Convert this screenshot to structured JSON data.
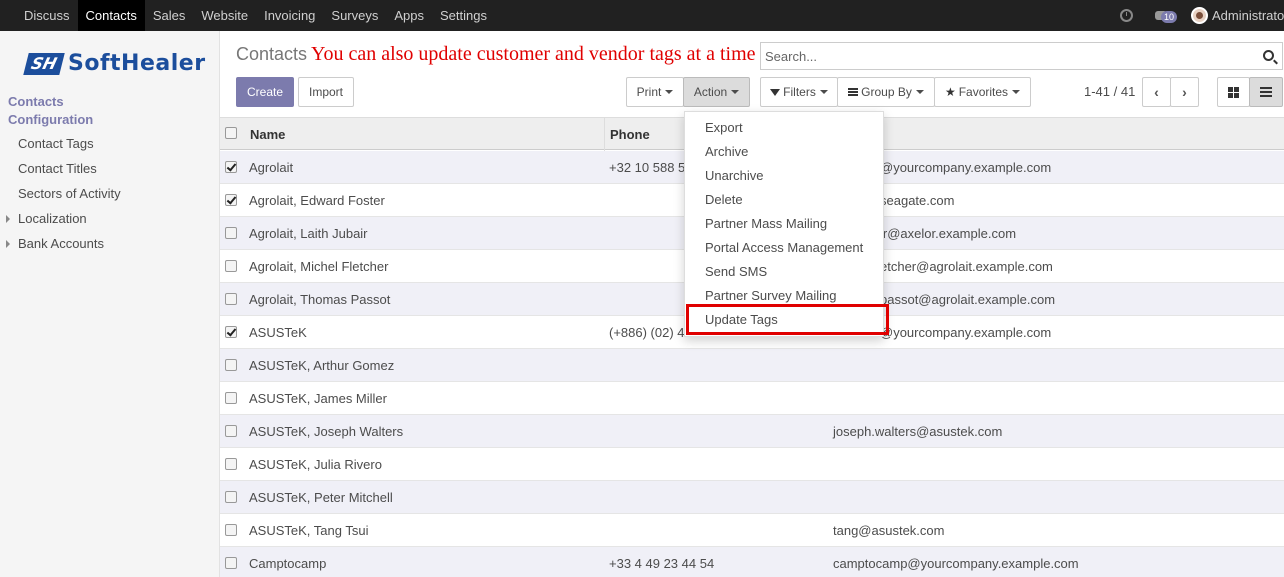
{
  "navbar": {
    "menu": [
      "Discuss",
      "Contacts",
      "Sales",
      "Website",
      "Invoicing",
      "Surveys",
      "Apps",
      "Settings"
    ],
    "active": "Contacts",
    "message_count": "10",
    "user_name": "Administrator"
  },
  "sidebar": {
    "logo_mark": "SH",
    "logo_text": "SoftHealer",
    "sections": [
      {
        "label": "Contacts"
      },
      {
        "label": "Configuration"
      }
    ],
    "items": [
      {
        "label": "Contact Tags"
      },
      {
        "label": "Contact Titles"
      },
      {
        "label": "Sectors of Activity"
      },
      {
        "label": "Localization"
      },
      {
        "label": "Bank Accounts"
      }
    ]
  },
  "control_panel": {
    "breadcrumb": "Contacts",
    "annotation": "You can also update customer and vendor tags at a time",
    "search_placeholder": "Search...",
    "create_label": "Create",
    "import_label": "Import",
    "print_label": "Print",
    "action_label": "Action",
    "filters_label": "Filters",
    "group_by_label": "Group By",
    "favorites_label": "Favorites",
    "pager": "1-41 / 41"
  },
  "table": {
    "columns": [
      "Name",
      "Phone"
    ],
    "rows": [
      {
        "name": "Agrolait",
        "phone": "+32 10 588 5",
        "email": "@yourcompany.example.com",
        "checked": true
      },
      {
        "name": "Agrolait, Edward Foster",
        "phone": "",
        "email": "seagate.com",
        "checked": true
      },
      {
        "name": "Agrolait, Laith Jubair",
        "phone": "",
        "email": "ir@axelor.example.com",
        "checked": false
      },
      {
        "name": "Agrolait, Michel Fletcher",
        "phone": "",
        "email": "etcher@agrolait.example.com",
        "checked": false
      },
      {
        "name": "Agrolait, Thomas Passot",
        "phone": "",
        "email": "passot@agrolait.example.com",
        "checked": false
      },
      {
        "name": "ASUSTeK",
        "phone": "(+886) (02) 4",
        "email": "@yourcompany.example.com",
        "checked": true
      },
      {
        "name": "ASUSTeK, Arthur Gomez",
        "phone": "",
        "email": "",
        "checked": false
      },
      {
        "name": "ASUSTeK, James Miller",
        "phone": "",
        "email": "",
        "checked": false
      },
      {
        "name": "ASUSTeK, Joseph Walters",
        "phone": "",
        "email": "joseph.walters@asustek.com",
        "checked": false
      },
      {
        "name": "ASUSTeK, Julia Rivero",
        "phone": "",
        "email": "",
        "checked": false
      },
      {
        "name": "ASUSTeK, Peter Mitchell",
        "phone": "",
        "email": "",
        "checked": false
      },
      {
        "name": "ASUSTeK, Tang Tsui",
        "phone": "",
        "email": "tang@asustek.com",
        "checked": false
      },
      {
        "name": "Camptocamp",
        "phone": "+33 4 49 23 44 54",
        "email": "camptocamp@yourcompany.example.com",
        "checked": false
      }
    ]
  },
  "action_menu": {
    "items": [
      "Export",
      "Archive",
      "Unarchive",
      "Delete",
      "Partner Mass Mailing",
      "Portal Access Management",
      "Send SMS",
      "Partner Survey Mailing",
      "Update Tags"
    ],
    "highlighted": "Update Tags"
  },
  "colors": {
    "navbar_bg": "#212121",
    "accent": "#7c7bad",
    "logo": "#1c4e9c",
    "annotation": "#e00000"
  }
}
